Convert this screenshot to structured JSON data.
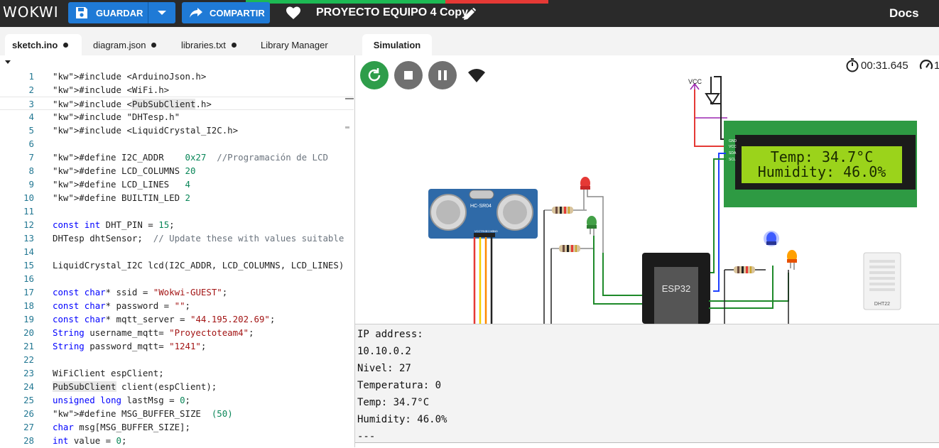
{
  "app": {
    "logo": "WOKWI",
    "save_label": "GUARDAR",
    "share_label": "COMPARTIR",
    "project_title": "PROYECTO EQUIPO 4 Copy",
    "docs_label": "Docs"
  },
  "editor": {
    "tabs": [
      {
        "label": "sketch.ino",
        "modified": true,
        "active": true
      },
      {
        "label": "diagram.json",
        "modified": true,
        "active": false
      },
      {
        "label": "libraries.txt",
        "modified": true,
        "active": false
      },
      {
        "label": "Library Manager",
        "modified": false,
        "active": false
      }
    ],
    "lines": [
      {
        "n": "1",
        "t": "#include <ArduinoJson.h>"
      },
      {
        "n": "2",
        "t": "#include <WiFi.h>"
      },
      {
        "n": "3",
        "t": "#include <PubSubClient.h>"
      },
      {
        "n": "4",
        "t": "#include \"DHTesp.h\""
      },
      {
        "n": "5",
        "t": "#include <LiquidCrystal_I2C.h>"
      },
      {
        "n": "6",
        "t": ""
      },
      {
        "n": "7",
        "t": "#define I2C_ADDR    0x27  //Programación de LCD"
      },
      {
        "n": "8",
        "t": "#define LCD_COLUMNS 20"
      },
      {
        "n": "9",
        "t": "#define LCD_LINES   4"
      },
      {
        "n": "10",
        "t": "#define BUILTIN_LED 2"
      },
      {
        "n": "11",
        "t": ""
      },
      {
        "n": "12",
        "t": "const int DHT_PIN = 15;"
      },
      {
        "n": "13",
        "t": "DHTesp dhtSensor;  // Update these with values suitable"
      },
      {
        "n": "14",
        "t": ""
      },
      {
        "n": "15",
        "t": "LiquidCrystal_I2C lcd(I2C_ADDR, LCD_COLUMNS, LCD_LINES)"
      },
      {
        "n": "16",
        "t": ""
      },
      {
        "n": "17",
        "t": "const char* ssid = \"Wokwi-GUEST\";"
      },
      {
        "n": "18",
        "t": "const char* password = \"\";"
      },
      {
        "n": "19",
        "t": "const char* mqtt_server = \"44.195.202.69\";"
      },
      {
        "n": "20",
        "t": "String username_mqtt= \"Proyectoteam4\";"
      },
      {
        "n": "21",
        "t": "String password_mqtt= \"1241\";"
      },
      {
        "n": "22",
        "t": ""
      },
      {
        "n": "23",
        "t": "WiFiClient espClient;"
      },
      {
        "n": "24",
        "t": "PubSubClient client(espClient);"
      },
      {
        "n": "25",
        "t": "unsigned long lastMsg = 0;"
      },
      {
        "n": "26",
        "t": "#define MSG_BUFFER_SIZE  (50)"
      },
      {
        "n": "27",
        "t": "char msg[MSG_BUFFER_SIZE];"
      },
      {
        "n": "28",
        "t": "int value = 0;"
      }
    ]
  },
  "simulation": {
    "tab_label": "Simulation",
    "timer": "00:31.645",
    "speed": "1",
    "lcd_line1": "Temp: 34.7°C",
    "lcd_line2": "Humidity: 46.0%",
    "vcc_label": "VCC",
    "esp_label": "ESP32",
    "ultrasonic_label": "HC-SR04",
    "ultrasonic_pins": [
      "VCC",
      "TRIG",
      "ECHO",
      "GND"
    ],
    "dht_label": "DHT22",
    "lcd_pins": [
      "GND",
      "VCC",
      "SDA",
      "SCL"
    ]
  },
  "serial_monitor": {
    "lines": [
      "IP address:",
      "10.10.0.2",
      "Nivel: 27",
      "Temperatura: 0",
      "Temp: 34.7°C",
      "Humidity: 46.0%",
      "---"
    ]
  },
  "colors": {
    "topbar": "#2a2a2a",
    "button_blue": "#1f7ad6",
    "restart_green": "#2e9d4a",
    "control_gray": "#707070",
    "lcd_green": "#2e9a43",
    "lcd_screen": "#9bd31b"
  }
}
